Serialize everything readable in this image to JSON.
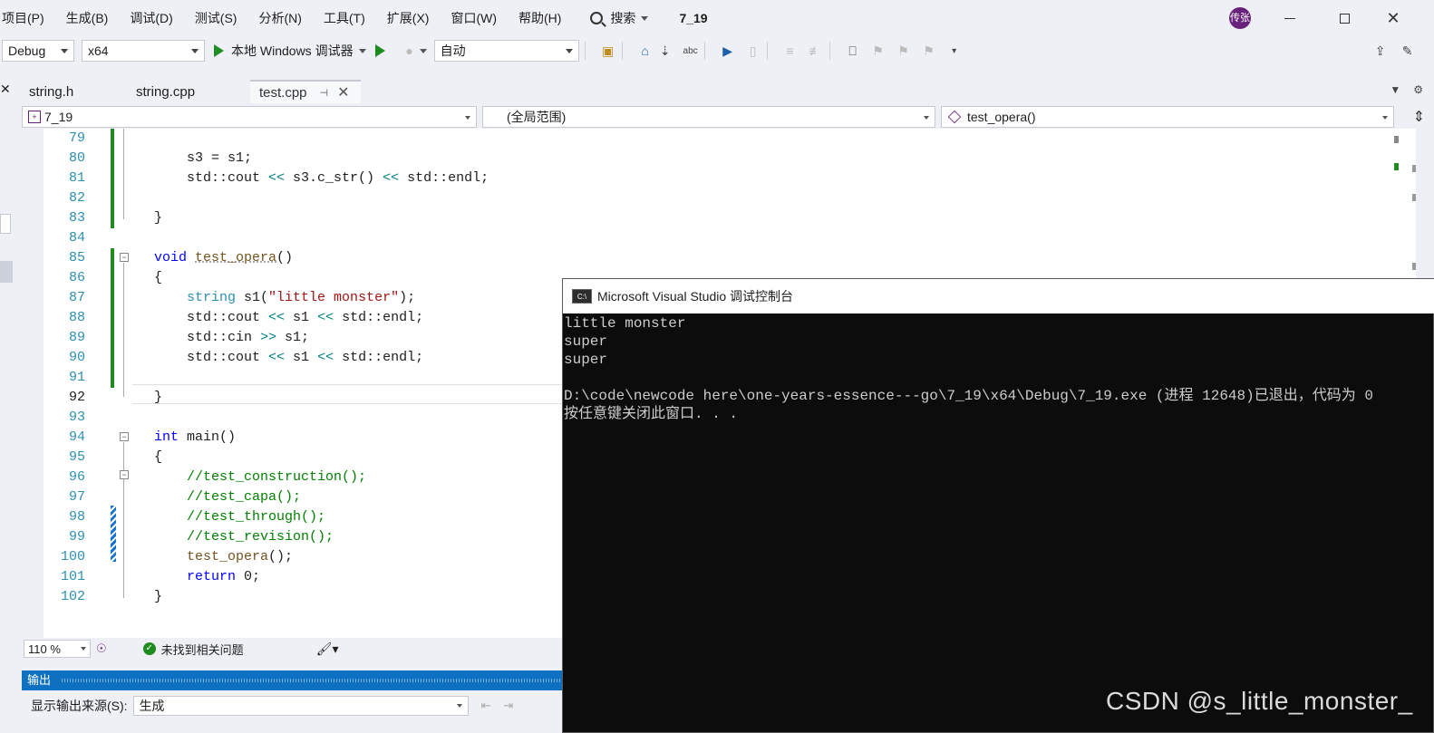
{
  "menubar": {
    "items": [
      "项目(P)",
      "生成(B)",
      "调试(D)",
      "测试(S)",
      "分析(N)",
      "工具(T)",
      "扩展(X)",
      "窗口(W)",
      "帮助(H)"
    ],
    "search_label": "搜索",
    "solution_name": "7_19",
    "avatar_text": "传张"
  },
  "toolbar": {
    "config": "Debug",
    "platform": "x64",
    "run_label": "本地 Windows 调试器",
    "auto_label": "自动"
  },
  "tabs": [
    {
      "label": "string.h",
      "active": false
    },
    {
      "label": "string.cpp",
      "active": false
    },
    {
      "label": "test.cpp",
      "active": true
    }
  ],
  "navbar": {
    "project": "7_19",
    "scope": "(全局范围)",
    "member": "test_opera()"
  },
  "editor": {
    "lines": [
      {
        "n": "79"
      },
      {
        "n": "80"
      },
      {
        "n": "81"
      },
      {
        "n": "82"
      },
      {
        "n": "83"
      },
      {
        "n": "84"
      },
      {
        "n": "85"
      },
      {
        "n": "86"
      },
      {
        "n": "87"
      },
      {
        "n": "88"
      },
      {
        "n": "89"
      },
      {
        "n": "90"
      },
      {
        "n": "91"
      },
      {
        "n": "92"
      },
      {
        "n": "93"
      },
      {
        "n": "94"
      },
      {
        "n": "95"
      },
      {
        "n": "96"
      },
      {
        "n": "97"
      },
      {
        "n": "98"
      },
      {
        "n": "99"
      },
      {
        "n": "100"
      },
      {
        "n": "101"
      },
      {
        "n": "102"
      }
    ],
    "code": {
      "l80_a": "    s3 = s1;",
      "l81_a": "    std::cout ",
      "l81_b": "<<",
      "l81_c": " s3.c_str() ",
      "l81_d": "<<",
      "l81_e": " std::endl;",
      "l83": "}",
      "l85_kw": "void",
      "l85_fn": "test_opera",
      "l85_rest": "()",
      "l86": "{",
      "l87_ty": "string",
      "l87_a": " s1(",
      "l87_str": "\"little monster\"",
      "l87_b": ");",
      "l88_a": "    std::cout ",
      "l88_b": "<<",
      "l88_c": " s1 ",
      "l88_d": "<<",
      "l88_e": " std::endl;",
      "l89_a": "    std::cin ",
      "l89_b": ">>",
      "l89_c": " s1;",
      "l90_a": "    std::cout ",
      "l90_b": "<<",
      "l90_c": " s1 ",
      "l90_d": "<<",
      "l90_e": " std::endl;",
      "l92": "}",
      "l94_kw": "int",
      "l94_rest": " main()",
      "l95": "{",
      "l96": "    //test_construction();",
      "l97": "    //test_capa();",
      "l98": "    //test_through();",
      "l99": "    //test_revision();",
      "l100_fn": "test_opera",
      "l100_rest": "();",
      "l101_kw": "return",
      "l101_rest": " 0;",
      "l102": "}"
    }
  },
  "status": {
    "zoom": "110 %",
    "issues": "未找到相关问题"
  },
  "output": {
    "title": "输出",
    "source_label": "显示输出来源(S):",
    "source_value": "生成"
  },
  "console": {
    "title": "Microsoft Visual Studio 调试控制台",
    "lines": [
      "little monster",
      "super",
      "super",
      "",
      "D:\\code\\newcode here\\one-years-essence---go\\7_19\\x64\\Debug\\7_19.exe (进程 12648)已退出，代码为 0",
      "按任意键关闭此窗口. . ."
    ]
  },
  "watermark": "CSDN @s_little_monster_"
}
